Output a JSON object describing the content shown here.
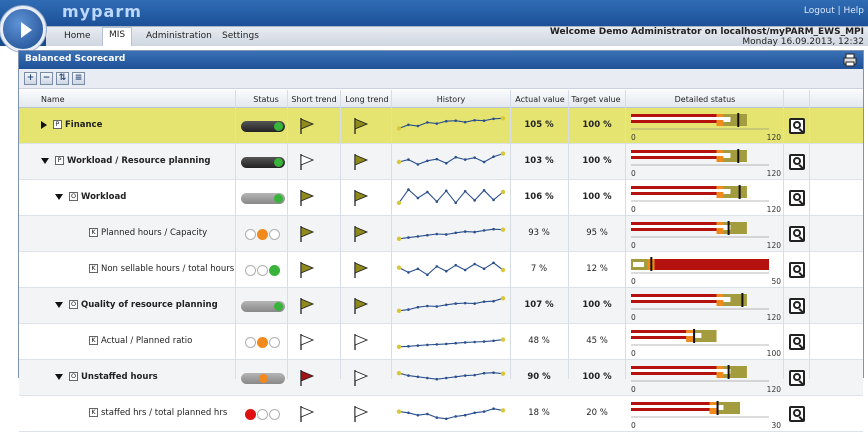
{
  "app": {
    "logo": "myparm",
    "top_right": "Logout | Help"
  },
  "menu": {
    "items": [
      "Home",
      "MIS",
      "Administration",
      "Settings"
    ],
    "active": "MIS"
  },
  "welcome": {
    "line1": "Welcome Demo Administrator on localhost/myPARM_EWS_MPI",
    "line2": "Monday 16.09.2013, 12:32"
  },
  "panel": {
    "title": "Balanced Scorecard"
  },
  "toolbar": {
    "buttons": [
      "+",
      "−",
      "⇅",
      "≡"
    ]
  },
  "columns": [
    "Name",
    "Status",
    "Short trend",
    "Long trend",
    "History",
    "Actual value",
    "Target value",
    "Detailed status"
  ],
  "colors": {
    "header_blue": "#1f5199",
    "finance_highlight": "#e6e470",
    "bar_red": "#b5120f",
    "bar_olive": "#a39c3e",
    "bar_orange": "#f08a1c",
    "green": "#38b43a",
    "orange": "#f08a1c",
    "red": "#e01010"
  },
  "rows": [
    {
      "name": "Finance",
      "indent": 0,
      "bold": true,
      "expander": "right",
      "type_icon": "P",
      "status": {
        "kind": "pill",
        "tone": "dark",
        "dot": "green"
      },
      "short_flag": "olive",
      "long_flag": "olive",
      "actual": "105 %",
      "target": "100 %",
      "axis_max": "120",
      "history": [
        0.4,
        0.55,
        0.5,
        0.65,
        0.6,
        0.7,
        0.72,
        0.66,
        0.74,
        0.72,
        0.8,
        0.82
      ],
      "highlight": true
    },
    {
      "name": "Workload / Resource planning",
      "indent": 1,
      "bold": true,
      "expander": "down",
      "type_icon": "P",
      "status": {
        "kind": "pill",
        "tone": "dark",
        "dot": "green"
      },
      "short_flag": "white",
      "long_flag": "olive",
      "actual": "103 %",
      "target": "100 %",
      "axis_max": "120",
      "history": [
        0.5,
        0.6,
        0.4,
        0.55,
        0.62,
        0.45,
        0.7,
        0.6,
        0.68,
        0.5,
        0.72,
        0.85
      ]
    },
    {
      "name": "Workload",
      "indent": 2,
      "bold": true,
      "expander": "down",
      "type_icon": "O",
      "status": {
        "kind": "pill",
        "tone": "grey",
        "dot": "green"
      },
      "short_flag": "olive",
      "long_flag": "olive",
      "actual": "106 %",
      "target": "100 %",
      "axis_max": "120",
      "history": [
        0.3,
        0.85,
        0.5,
        0.75,
        0.35,
        0.8,
        0.3,
        0.78,
        0.4,
        0.82,
        0.42,
        0.75
      ]
    },
    {
      "name": "Planned hours / Capacity",
      "indent": 3,
      "bold": false,
      "expander": "none",
      "type_icon": "K",
      "status": {
        "kind": "dots",
        "lit": 1,
        "lit_color": "orange"
      },
      "short_flag": "olive",
      "long_flag": "olive",
      "actual": "93 %",
      "target": "95 %",
      "axis_max": "120",
      "history": [
        0.3,
        0.35,
        0.4,
        0.45,
        0.5,
        0.48,
        0.55,
        0.6,
        0.58,
        0.65,
        0.7,
        0.68
      ]
    },
    {
      "name": "Non sellable hours / total hours",
      "indent": 3,
      "bold": false,
      "expander": "none",
      "type_icon": "K",
      "status": {
        "kind": "dots",
        "lit": 2,
        "lit_color": "green"
      },
      "short_flag": "olive",
      "long_flag": "olive",
      "actual": "7 %",
      "target": "12 %",
      "axis_max": "50",
      "history": [
        0.6,
        0.4,
        0.55,
        0.3,
        0.65,
        0.45,
        0.7,
        0.5,
        0.75,
        0.55,
        0.8,
        0.5
      ]
    },
    {
      "name": "Quality of resource planning",
      "indent": 2,
      "bold": true,
      "expander": "down",
      "type_icon": "O",
      "status": {
        "kind": "pill",
        "tone": "grey",
        "dot": "green"
      },
      "short_flag": "olive",
      "long_flag": "olive",
      "actual": "107 %",
      "target": "100 %",
      "axis_max": "120",
      "history": [
        0.3,
        0.35,
        0.45,
        0.5,
        0.48,
        0.55,
        0.6,
        0.62,
        0.6,
        0.68,
        0.7,
        0.82
      ]
    },
    {
      "name": "Actual / Planned ratio",
      "indent": 3,
      "bold": false,
      "expander": "none",
      "type_icon": "K",
      "status": {
        "kind": "dots",
        "lit": 1,
        "lit_color": "orange"
      },
      "short_flag": "white",
      "long_flag": "white",
      "actual": "48 %",
      "target": "45 %",
      "axis_max": "100",
      "history": [
        0.3,
        0.32,
        0.35,
        0.38,
        0.4,
        0.42,
        0.45,
        0.48,
        0.5,
        0.52,
        0.55,
        0.6
      ]
    },
    {
      "name": "Unstaffed hours",
      "indent": 2,
      "bold": true,
      "expander": "down",
      "type_icon": "O",
      "status": {
        "kind": "pill",
        "tone": "grey",
        "dot": "orange"
      },
      "short_flag": "red",
      "long_flag": "white",
      "actual": "90 %",
      "target": "100 %",
      "axis_max": "120",
      "history": [
        0.7,
        0.6,
        0.55,
        0.5,
        0.45,
        0.5,
        0.55,
        0.6,
        0.62,
        0.7,
        0.72,
        0.68
      ]
    },
    {
      "name": "staffed hrs / total planned hrs",
      "indent": 3,
      "bold": false,
      "expander": "none",
      "type_icon": "K",
      "status": {
        "kind": "dots",
        "lit": 0,
        "lit_color": "red"
      },
      "short_flag": "white",
      "long_flag": "white",
      "actual": "18 %",
      "target": "20 %",
      "axis_max": "30",
      "history": [
        0.6,
        0.55,
        0.45,
        0.5,
        0.35,
        0.3,
        0.4,
        0.45,
        0.55,
        0.6,
        0.72,
        0.65
      ]
    }
  ]
}
